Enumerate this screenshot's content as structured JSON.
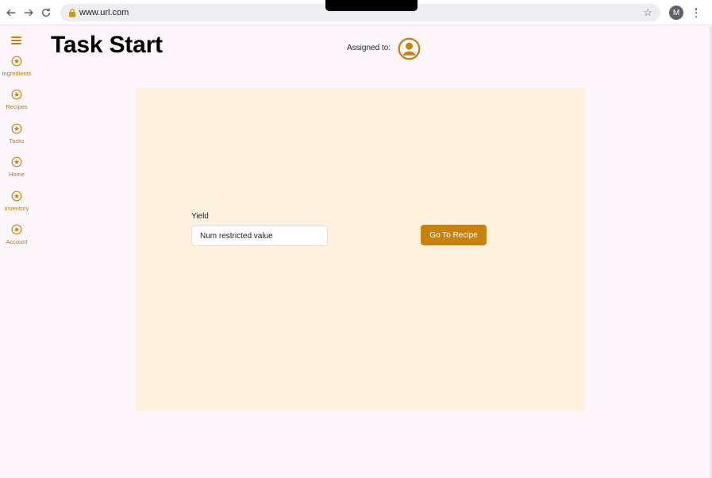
{
  "browser": {
    "url": "www.url.com",
    "profile_initial": "M"
  },
  "sidebar": {
    "items": [
      {
        "label": "Ingredients"
      },
      {
        "label": "Recipes"
      },
      {
        "label": "Tasks"
      },
      {
        "label": "Home"
      },
      {
        "label": "Inventory"
      },
      {
        "label": "Account"
      }
    ]
  },
  "header": {
    "title": "Task Start",
    "assigned_label": "Assigned to:"
  },
  "form": {
    "yield_label": "Yield",
    "yield_value": "Num restricted value",
    "go_button": "Go To Recipe"
  },
  "colors": {
    "accent": "#c7820e",
    "card_background": "#fef2de",
    "page_background": "#fdf7fc"
  }
}
